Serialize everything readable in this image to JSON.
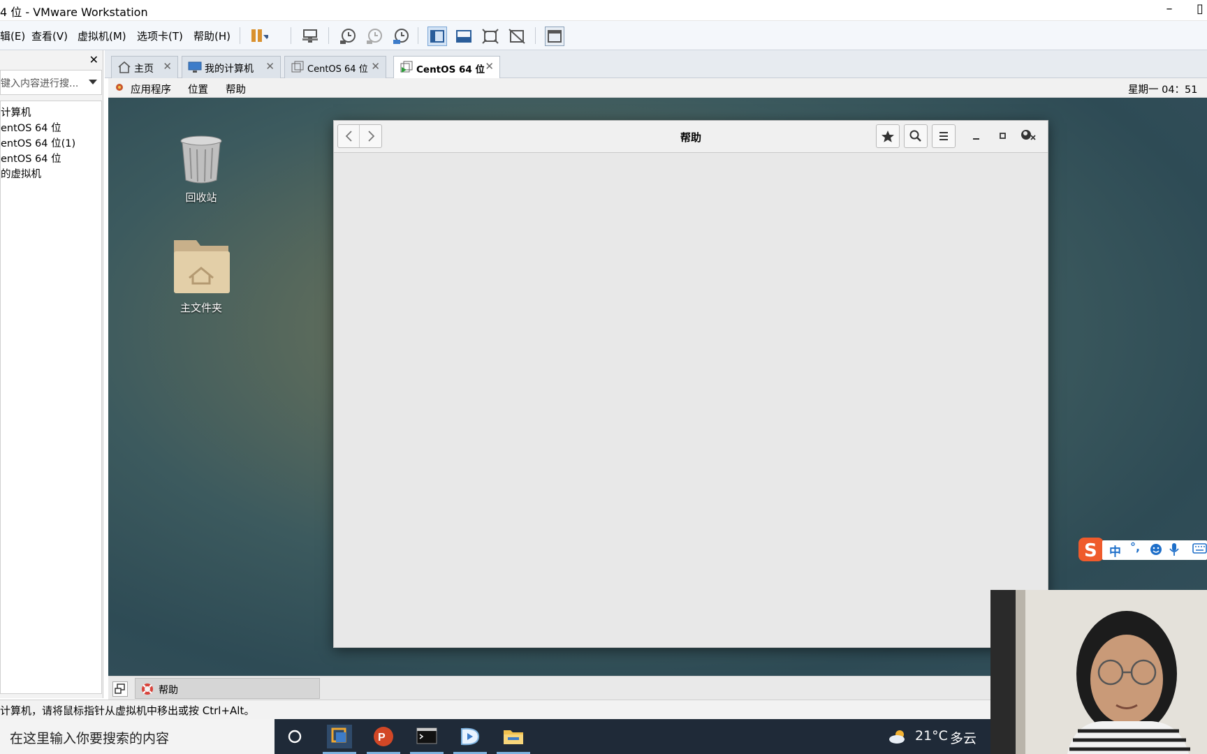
{
  "window": {
    "title": "4 位 - VMware Workstation",
    "minimize_glyph": "–",
    "close_glyph": "✕"
  },
  "menubar": {
    "items": [
      "辑(E)",
      "查看(V)",
      "虚拟机(M)",
      "选项卡(T)",
      "帮助(H)"
    ]
  },
  "library": {
    "close_glyph": "✕",
    "search_placeholder": "键入内容进行搜...",
    "items": [
      "计算机",
      "entOS 64 位",
      "entOS 64 位(1)",
      "entOS 64 位",
      "的虚拟机"
    ]
  },
  "tabs": [
    {
      "label": "主页",
      "icon": "home-icon",
      "active": false
    },
    {
      "label": "我的计算机",
      "icon": "computer-icon",
      "active": false
    },
    {
      "label": "CentOS 64 位",
      "icon": "vm-icon",
      "active": false
    },
    {
      "label": "CentOS 64 位",
      "icon": "vm-running-icon",
      "active": true
    }
  ],
  "tab_close_glyph": "✕",
  "gnome": {
    "applications": "应用程序",
    "places": "位置",
    "help": "帮助",
    "clock": "星期一 04：51"
  },
  "desktop": {
    "icons": [
      {
        "label": "回收站",
        "icon": "trash-icon"
      },
      {
        "label": "主文件夹",
        "icon": "home-folder-icon"
      }
    ]
  },
  "help_window": {
    "title": "帮助"
  },
  "vm_taskbar": {
    "task_label": "帮助"
  },
  "statusbar": {
    "text": "计算机，请将鼠标指针从虚拟机中移出或按 Ctrl+Alt。"
  },
  "taskbar": {
    "search_placeholder": "在这里输入你要搜索的内容",
    "weather_temp": "21°C",
    "weather_desc": "多云"
  },
  "ime": {
    "lang": "中",
    "punct": "°,"
  },
  "colors": {
    "accent": "#3d7cc9",
    "taskbar_bg": "#1f2a38"
  }
}
